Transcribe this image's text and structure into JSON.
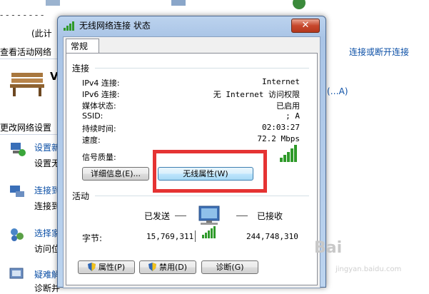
{
  "background": {
    "note_text": "(此计",
    "view_active_networks": "查看活动网络",
    "connect_disconnect_link": "连接或断开连接",
    "network_name_fragment": "V",
    "network_right_fragment": "(…A)",
    "change_settings": "更改网络设置",
    "items": [
      {
        "title": "设置新",
        "desc": "设置无"
      },
      {
        "title": "连接到",
        "desc": "连接到"
      },
      {
        "title": "选择家",
        "desc": "访问位"
      },
      {
        "title": "疑难解",
        "desc": "诊断并"
      }
    ]
  },
  "dialog": {
    "title": "无线网络连接 状态",
    "close_glyph": "✕",
    "tab": "常规",
    "connection": {
      "heading": "连接",
      "rows": [
        {
          "label": "IPv4 连接:",
          "value": "Internet"
        },
        {
          "label": "IPv6 连接:",
          "value": "无 Internet 访问权限"
        },
        {
          "label": "媒体状态:",
          "value": "已启用"
        },
        {
          "label": "SSID:",
          "value": "; A"
        },
        {
          "label": "持续时间:",
          "value": "02:03:27"
        },
        {
          "label": "速度:",
          "value": "72.2 Mbps"
        }
      ],
      "signal_label": "信号质量:",
      "signal_bars": 5,
      "details_button": "详细信息(E)...",
      "wireless_props_button": "无线属性(W)"
    },
    "activity": {
      "heading": "活动",
      "sent_label": "已发送",
      "received_label": "已接收",
      "bytes_label": "字节:",
      "bytes_sent": "15,769,311",
      "bytes_received": "244,748,310"
    },
    "buttons": {
      "properties": "属性(P)",
      "disable": "禁用(D)",
      "diagnose": "诊断(G)"
    }
  },
  "watermark": {
    "logo": "Bai",
    "sub": "jingyan.baidu.com"
  },
  "colors": {
    "highlight": "#e53333",
    "link": "#0b4fa6",
    "signal": "#2f9a2a"
  }
}
